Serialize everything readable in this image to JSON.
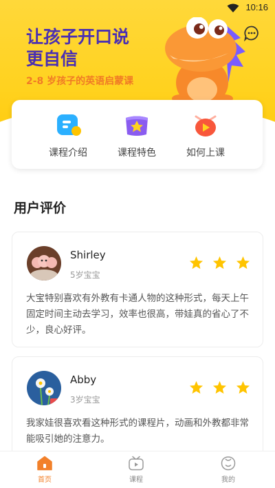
{
  "status_bar": {
    "time": "10:16"
  },
  "hero": {
    "title_line1": "让孩子开口说",
    "title_line2": "更自信",
    "subtitle": "2-8 岁孩子的英语启蒙课"
  },
  "course_menu": [
    {
      "label": "课程介绍",
      "icon": "course-intro-icon"
    },
    {
      "label": "课程特色",
      "icon": "course-feature-icon"
    },
    {
      "label": "如何上课",
      "icon": "how-to-class-icon"
    }
  ],
  "reviews_section": {
    "title": "用户评价",
    "items": [
      {
        "name": "Shirley",
        "age": "5岁宝宝",
        "rating": 3,
        "text": "大宝特别喜欢有外教有卡通人物的这种形式，每天上午固定时间主动去学习，效率也很高，带娃真的省心了不少，良心好评。"
      },
      {
        "name": "Abby",
        "age": "3岁宝宝",
        "rating": 3,
        "text": "我家娃很喜欢看这种形式的课程片，动画和外教都非常能吸引她的注意力。"
      }
    ]
  },
  "tabbar": [
    {
      "label": "首页",
      "active": true
    },
    {
      "label": "课程",
      "active": false
    },
    {
      "label": "我的",
      "active": false
    }
  ],
  "colors": {
    "hero_yellow": "#ffd21f",
    "title_purple": "#4a2fb3",
    "accent_orange": "#f2802a",
    "star_yellow": "#ffc400"
  }
}
